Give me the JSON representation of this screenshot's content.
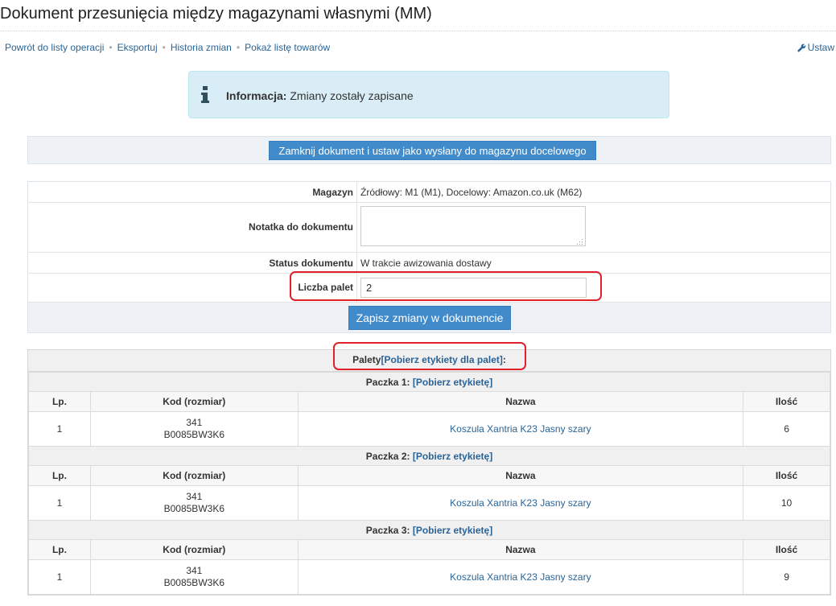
{
  "page": {
    "title": "Dokument przesunięcia między magazynami własnymi (MM)"
  },
  "nav": {
    "items": [
      "Powrót do listy operacji",
      "Eksportuj",
      "Historia zmian",
      "Pokaż listę towarów"
    ],
    "separator": "•",
    "settings_label": "Ustaw",
    "settings_icon": "wrench-icon"
  },
  "alert": {
    "icon": "info-icon",
    "label": "Informacja:",
    "message": "Zmiany zostały zapisane"
  },
  "close_button_label": "Zamknij dokument i ustaw jako wysłany do magazynu docelowego",
  "form": {
    "warehouse_label": "Magazyn",
    "warehouse_value": "Źródłowy: M1 (M1), Docelowy: Amazon.co.uk (M62)",
    "note_label": "Notatka do dokumentu",
    "note_value": "",
    "status_label": "Status dokumentu",
    "status_value": "W trakcie awizowania dostawy",
    "pallets_label": "Liczba palet",
    "pallets_value": "2",
    "save_button_label": "Zapisz zmiany w dokumencie"
  },
  "pallets": {
    "prefix": "Palety",
    "labels_link": "[Pobierz etykiety dla palet]",
    "suffix": ":",
    "columns": [
      "Lp.",
      "Kod (rozmiar)",
      "Nazwa",
      "Ilość"
    ],
    "packages": [
      {
        "title": "Paczka 1:",
        "link": "[Pobierz etykietę]",
        "items": [
          {
            "lp": "1",
            "code": "341",
            "size": "B0085BW3K6",
            "name": "Koszula Xantria K23 Jasny szary",
            "qty": "6"
          }
        ]
      },
      {
        "title": "Paczka 2:",
        "link": "[Pobierz etykietę]",
        "items": [
          {
            "lp": "1",
            "code": "341",
            "size": "B0085BW3K6",
            "name": "Koszula Xantria K23 Jasny szary",
            "qty": "10"
          }
        ]
      },
      {
        "title": "Paczka 3:",
        "link": "[Pobierz etykietę]",
        "items": [
          {
            "lp": "1",
            "code": "341",
            "size": "B0085BW3K6",
            "name": "Koszula Xantria K23 Jasny szary",
            "qty": "9"
          }
        ]
      }
    ]
  },
  "colors": {
    "primary": "#428bca",
    "link": "#2a6496",
    "info_bg": "#d9edf7",
    "highlight": "#e0202a"
  }
}
